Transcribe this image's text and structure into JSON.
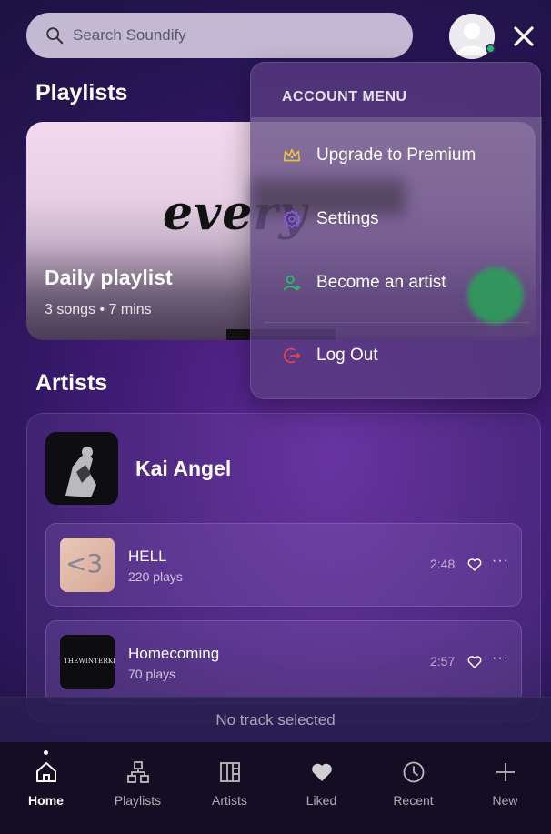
{
  "search": {
    "placeholder": "Search Soundify"
  },
  "header": {
    "avatar": "user-avatar",
    "online": true,
    "close_icon": "close-icon"
  },
  "playlists": {
    "title": "Playlists",
    "card": {
      "cover_text": "every",
      "title": "Daily playlist",
      "meta": "3 songs  •  7 mins"
    }
  },
  "artists": {
    "title": "Artists",
    "artist": {
      "name": "Kai Angel"
    },
    "tracks": [
      {
        "title": "HELL",
        "plays": "220 plays",
        "duration": "2:48",
        "thumb_text": "<3"
      },
      {
        "title": "Homecoming",
        "plays": "70 plays",
        "duration": "2:57",
        "thumb_text": "THEWINTERKING"
      }
    ]
  },
  "now_playing": {
    "text": "No track selected"
  },
  "nav": [
    {
      "label": "Home",
      "icon": "home-icon",
      "active": true
    },
    {
      "label": "Playlists",
      "icon": "playlists-icon",
      "active": false
    },
    {
      "label": "Artists",
      "icon": "artists-icon",
      "active": false
    },
    {
      "label": "Liked",
      "icon": "heart-icon",
      "active": false
    },
    {
      "label": "Recent",
      "icon": "clock-icon",
      "active": false
    },
    {
      "label": "New",
      "icon": "plus-icon",
      "active": false
    }
  ],
  "menu": {
    "heading": "ACCOUNT MENU",
    "items": [
      {
        "label": "Upgrade to Premium",
        "icon": "crown-icon",
        "color": "#e8c23a"
      },
      {
        "label": "Settings",
        "icon": "gear-icon",
        "color": "#8b5cf6"
      },
      {
        "label": "Become an artist",
        "icon": "user-plus-icon",
        "color": "#22c55e"
      },
      {
        "label": "Log Out",
        "icon": "logout-icon",
        "color": "#ef4444"
      }
    ]
  },
  "colors": {
    "accent_green": "#22c55e",
    "nav_bg": "#140d24"
  }
}
